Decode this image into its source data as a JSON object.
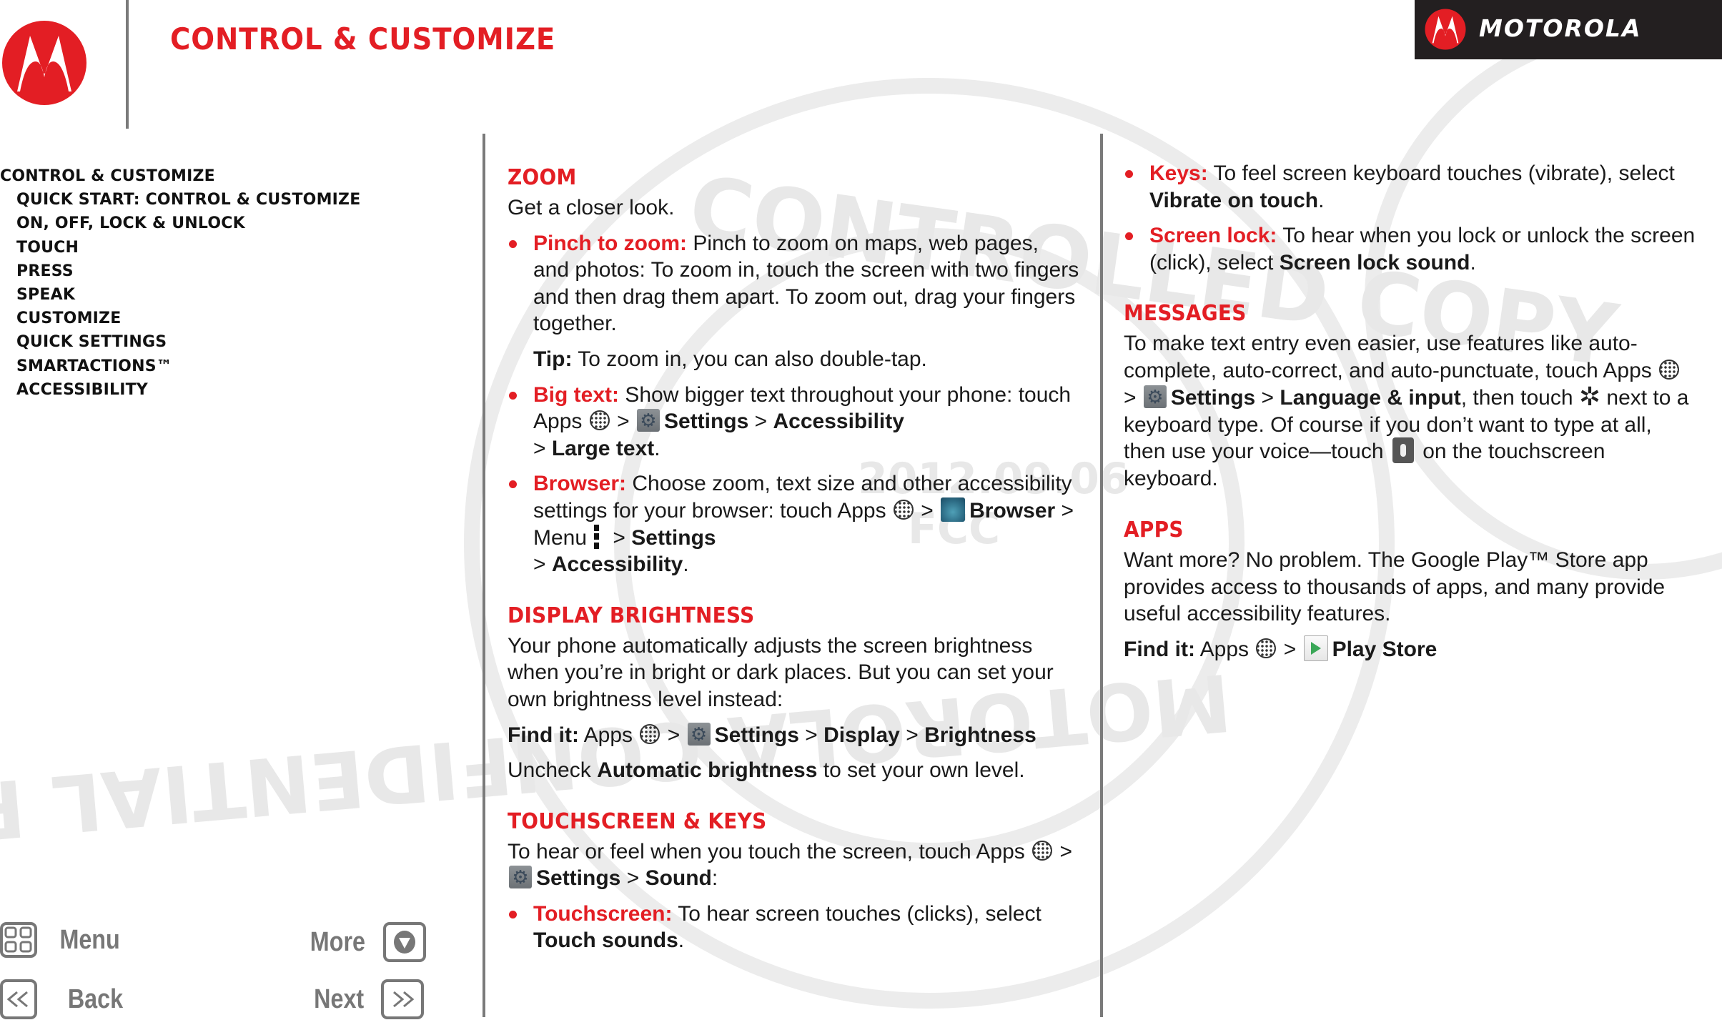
{
  "header": {
    "title": "CONTROL & CUSTOMIZE",
    "brand_name": "MOTOROLA"
  },
  "colors": {
    "accent_red": "#e31e24",
    "badge_black": "#231f20",
    "divider_gray": "#7a7a7a",
    "nav_gray": "#777777"
  },
  "toc": {
    "items": [
      {
        "label": "CONTROL & CUSTOMIZE",
        "level": 0
      },
      {
        "label": "QUICK START: CONTROL & CUSTOMIZE",
        "level": 1
      },
      {
        "label": "ON, OFF, LOCK & UNLOCK",
        "level": 1
      },
      {
        "label": "TOUCH",
        "level": 1
      },
      {
        "label": "PRESS",
        "level": 1
      },
      {
        "label": "SPEAK",
        "level": 1
      },
      {
        "label": "CUSTOMIZE",
        "level": 1
      },
      {
        "label": "QUICK SETTINGS",
        "level": 1
      },
      {
        "label": "SMARTACTIONS™",
        "level": 1
      },
      {
        "label": "ACCESSIBILITY",
        "level": 1
      }
    ]
  },
  "nav": {
    "menu": "Menu",
    "more": "More",
    "back": "Back",
    "next": "Next"
  },
  "icons": {
    "apps": "apps-icon",
    "settings": "settings-gear-icon",
    "browser": "browser-icon",
    "menu": "overflow-menu-icon",
    "keyboard_settings": "gear-icon",
    "mic": "microphone-icon",
    "play_store": "play-store-icon"
  },
  "zoom": {
    "heading": "ZOOM",
    "intro": "Get a closer look.",
    "pinch": {
      "lead": "Pinch to zoom:",
      "text": " Pinch to zoom on maps, web pages, and photos: To zoom in, touch the screen with two fingers and then drag them apart. To zoom out, drag your fingers together."
    },
    "tip": {
      "lead": "Tip:",
      "text": " To zoom in, you can also double-tap."
    },
    "big_text": {
      "lead": "Big text:",
      "text": " Show bigger text throughout your phone: touch Apps",
      "sep1": " > ",
      "settings": "Settings",
      "sep2": " > ",
      "accessibility": "Accessibility",
      "sep3": " > ",
      "large_text": "Large text",
      "end": "."
    },
    "browser": {
      "lead": "Browser:",
      "text": " Choose zoom, text size and other accessibility settings for your browser: touch Apps",
      "sep1": " > ",
      "browser": "Browser",
      "menu_text": " > Menu",
      "sep2": " > ",
      "settings": "Settings",
      "sep3": " > ",
      "accessibility": "Accessibility",
      "end": "."
    }
  },
  "display_brightness": {
    "heading": "DISPLAY BRIGHTNESS",
    "text": "Your phone automatically adjusts the screen brightness when you’re in bright or dark places. But you can set your own brightness level instead:",
    "find_it": {
      "lead": "Find it:",
      "apps": " Apps",
      "sep1": " > ",
      "settings": "Settings",
      "sep2": " > ",
      "display": "Display",
      "sep3": " > ",
      "brightness": "Brightness"
    },
    "uncheck": {
      "pre": "Uncheck ",
      "option": "Automatic brightness",
      "post": " to set your own level."
    }
  },
  "touchscreen_keys": {
    "heading": "TOUCHSCREEN & KEYS",
    "intro": "To hear or feel when you touch the screen, touch Apps",
    "sep1": " > ",
    "settings": "Settings",
    "sep2": " > ",
    "sound": "Sound",
    "end": ":",
    "touchscreen": {
      "lead": "Touchscreen:",
      "text": " To hear screen touches (clicks), select ",
      "option": "Touch sounds",
      "end": "."
    },
    "keys": {
      "lead": "Keys:",
      "text": " To feel screen keyboard touches (vibrate), select ",
      "option": "Vibrate on touch",
      "end": "."
    },
    "screen_lock": {
      "lead": "Screen lock:",
      "text": " To hear when you lock or unlock the screen (click), select ",
      "option": "Screen lock sound",
      "end": "."
    }
  },
  "messages": {
    "heading": "MESSAGES",
    "text1": "To make text entry even easier, use features like auto-complete, auto-correct, and auto-punctuate, touch Apps",
    "sep1": " > ",
    "settings": "Settings",
    "sep2": " > ",
    "language": "Language & input",
    "text2": ", then touch ",
    "text3": " next to a keyboard type. Of course if you don’t want to type at all, then use your voice—touch ",
    "text4": " on the touchscreen keyboard."
  },
  "apps": {
    "heading": "APPS",
    "text": "Want more? No problem. The Google Play™ Store app provides access to thousands of apps, and many provide useful accessibility features.",
    "find_it": {
      "lead": "Find it:",
      "apps": " Apps",
      "sep": " > ",
      "store": "Play Store"
    }
  },
  "watermark": {
    "lines": [
      "CONTROLLED COPY",
      "MOTOROLA CONFIDENTIAL RESTRICTED",
      "2012.09.06",
      "FCC"
    ]
  }
}
